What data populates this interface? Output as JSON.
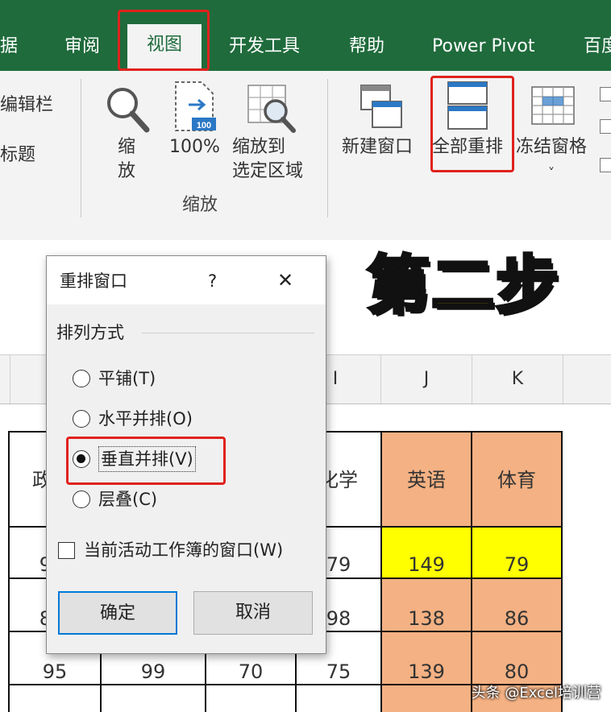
{
  "ribbon_tabs": [
    "据",
    "审阅",
    "视图",
    "开发工具",
    "帮助",
    "Power Pivot",
    "百度"
  ],
  "active_tab": "视图",
  "ribbon": {
    "left_items": [
      "编辑栏",
      "标题"
    ],
    "zoom_button": "缩放",
    "zoom100_button": "100%",
    "zoom_selection_line1": "缩放到",
    "zoom_selection_line2": "选定区域",
    "zoom_group_label": "缩放",
    "new_window": "新建窗口",
    "arrange_all": "全部重排",
    "freeze_panes": "冻结窗格",
    "freeze_caret": "˅"
  },
  "headline": "第二步",
  "dialog": {
    "title": "重排窗口",
    "help": "?",
    "close": "✕",
    "group_label": "排列方式",
    "options": [
      "平铺(T)",
      "水平并排(O)",
      "垂直并排(V)",
      "层叠(C)"
    ],
    "selected_option": "垂直并排(V)",
    "checkbox_label": "当前活动工作簿的窗口(W)",
    "checkbox_checked": false,
    "ok": "确定",
    "cancel": "取消"
  },
  "sheet": {
    "columns": [
      "I",
      "J",
      "K"
    ],
    "header_row": [
      "政",
      "化学",
      "英语",
      "体育"
    ],
    "rows": [
      [
        "9",
        "79",
        "149",
        "79"
      ],
      [
        "8",
        "98",
        "138",
        "86"
      ],
      [
        "95",
        "99",
        "70",
        "75",
        "139",
        "80"
      ]
    ]
  },
  "watermark": "头条 @Excel培训营",
  "colors": {
    "tab_bar": "#1f6b3c",
    "highlight_red": "#e0221c",
    "orange_cell": "#f4b183",
    "yellow_cell": "#ffff00",
    "headline_fill": "#ffe600"
  }
}
